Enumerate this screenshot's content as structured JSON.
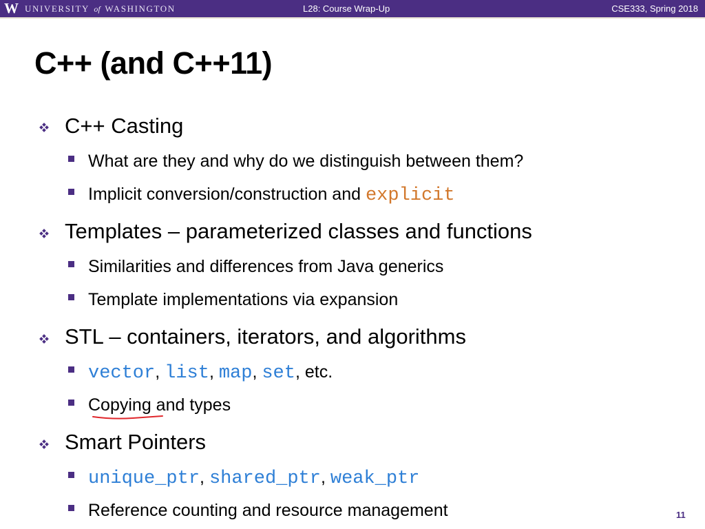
{
  "header": {
    "logo_letter": "W",
    "university_pre": "UNIVERSITY",
    "university_of": "of",
    "university_post": "WASHINGTON",
    "lecture": "L28:  Course Wrap-Up",
    "course": "CSE333, Spring 2018",
    "color": "#4b2e83"
  },
  "slide": {
    "title": "C++ (and C++11)",
    "sections": [
      {
        "heading": "C++ Casting",
        "items": [
          {
            "text": "What are they and why do we distinguish between them?"
          },
          {
            "text": "Implicit conversion/construction and ",
            "code": "explicit"
          }
        ]
      },
      {
        "heading": "Templates – parameterized classes and functions",
        "items": [
          {
            "text": "Similarities and differences from Java generics"
          },
          {
            "text": "Template implementations via expansion"
          }
        ]
      },
      {
        "heading": "STL – containers, iterators, and algorithms",
        "items": [
          {
            "code": [
              "vector",
              "list",
              "map",
              "set"
            ],
            "sep": ", ",
            "suffix": ", etc."
          },
          {
            "text_pre": "Copying",
            "text_post": " and types"
          }
        ]
      },
      {
        "heading": "Smart Pointers",
        "items": [
          {
            "code": [
              "unique_ptr",
              "shared_ptr",
              "weak_ptr"
            ],
            "sep": ", "
          },
          {
            "text": "Reference counting and resource management"
          }
        ]
      }
    ],
    "page_number": "11",
    "annotation_color": "#e0262b",
    "code_blue": "#2e7fd6",
    "code_orange": "#d2782c"
  }
}
